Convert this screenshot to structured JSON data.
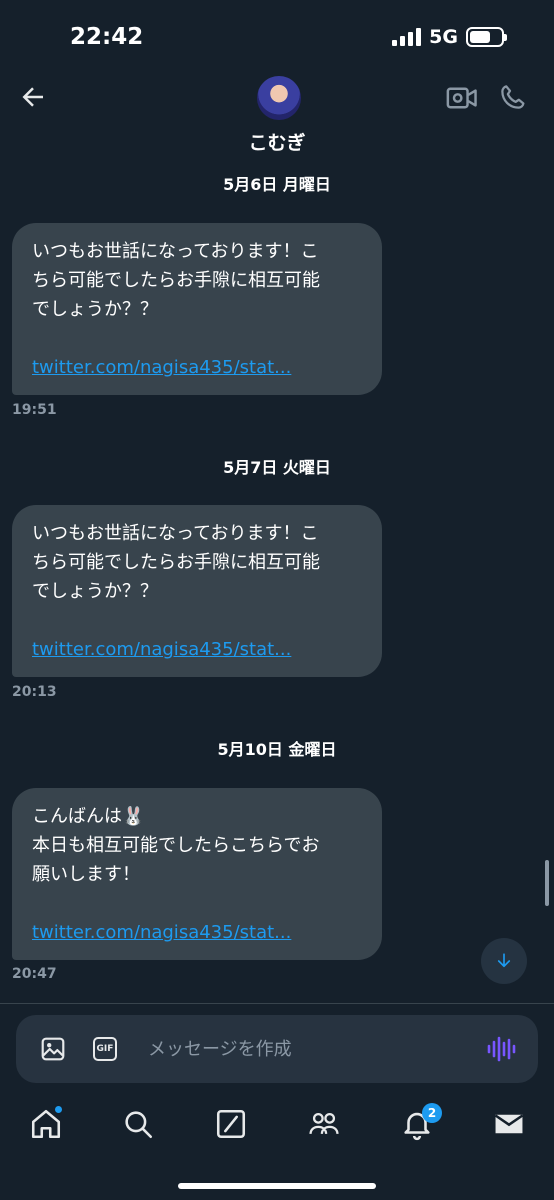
{
  "status": {
    "time": "22:42",
    "network": "5G"
  },
  "header": {
    "name": "こむぎ"
  },
  "messages": [
    {
      "date": "5月6日 月曜日",
      "lines": [
        "いつもお世話になっております！こ",
        "ちら可能でしたらお手隙に相互可能",
        "でしょうか？？"
      ],
      "link": "twitter.com/nagisa435/stat...",
      "time": "19:51"
    },
    {
      "date": "5月7日 火曜日",
      "lines": [
        "いつもお世話になっております！こ",
        "ちら可能でしたらお手隙に相互可能",
        "でしょうか？？"
      ],
      "link": "twitter.com/nagisa435/stat...",
      "time": "20:13"
    },
    {
      "date": "5月10日 金曜日",
      "lines": [
        "こんばんは🐰",
        "本日も相互可能でしたらこちらでお",
        "願いします！"
      ],
      "link": "twitter.com/nagisa435/stat...",
      "time": "20:47"
    }
  ],
  "composer": {
    "placeholder": "メッセージを作成",
    "gif_label": "GIF"
  },
  "tabbar": {
    "notifications_count": "2"
  },
  "colors": {
    "background": "#15202b",
    "bubble": "#38444d",
    "link": "#1d9bf0",
    "accent_voice": "#7856ff"
  },
  "icons": [
    "back-arrow-icon",
    "video-call-icon",
    "phone-icon",
    "image-icon",
    "gif-icon",
    "voice-icon",
    "arrow-down-icon",
    "home-icon",
    "search-icon",
    "grok-icon",
    "communities-icon",
    "notifications-icon",
    "messages-icon"
  ]
}
